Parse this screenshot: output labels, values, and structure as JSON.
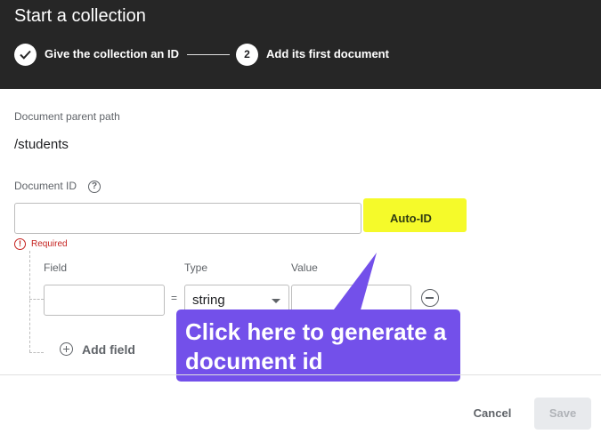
{
  "dialog": {
    "title": "Start a collection"
  },
  "stepper": {
    "step1_label": "Give the collection an ID",
    "step2_number": "2",
    "step2_label": "Add its first document"
  },
  "parent_path": {
    "label": "Document parent path",
    "value": "/students"
  },
  "document_id": {
    "label": "Document ID",
    "help_glyph": "?",
    "value": "",
    "auto_id_label": "Auto-ID",
    "error_glyph": "!",
    "required_text": "Required"
  },
  "fields": {
    "column_headers": [
      "Field",
      "Type",
      "Value"
    ],
    "equals_sign": "=",
    "row": {
      "field_value": "",
      "type_value": "string",
      "value_value": ""
    },
    "add_field_label": "Add field"
  },
  "annotation": {
    "callout_text": "Click here to generate a document id",
    "callout_color": "#7350ea",
    "highlight_color": "#f5fa2a"
  },
  "footer": {
    "cancel_label": "Cancel",
    "save_label": "Save"
  },
  "colors": {
    "header_bg": "#262626",
    "error": "#c5221f"
  }
}
